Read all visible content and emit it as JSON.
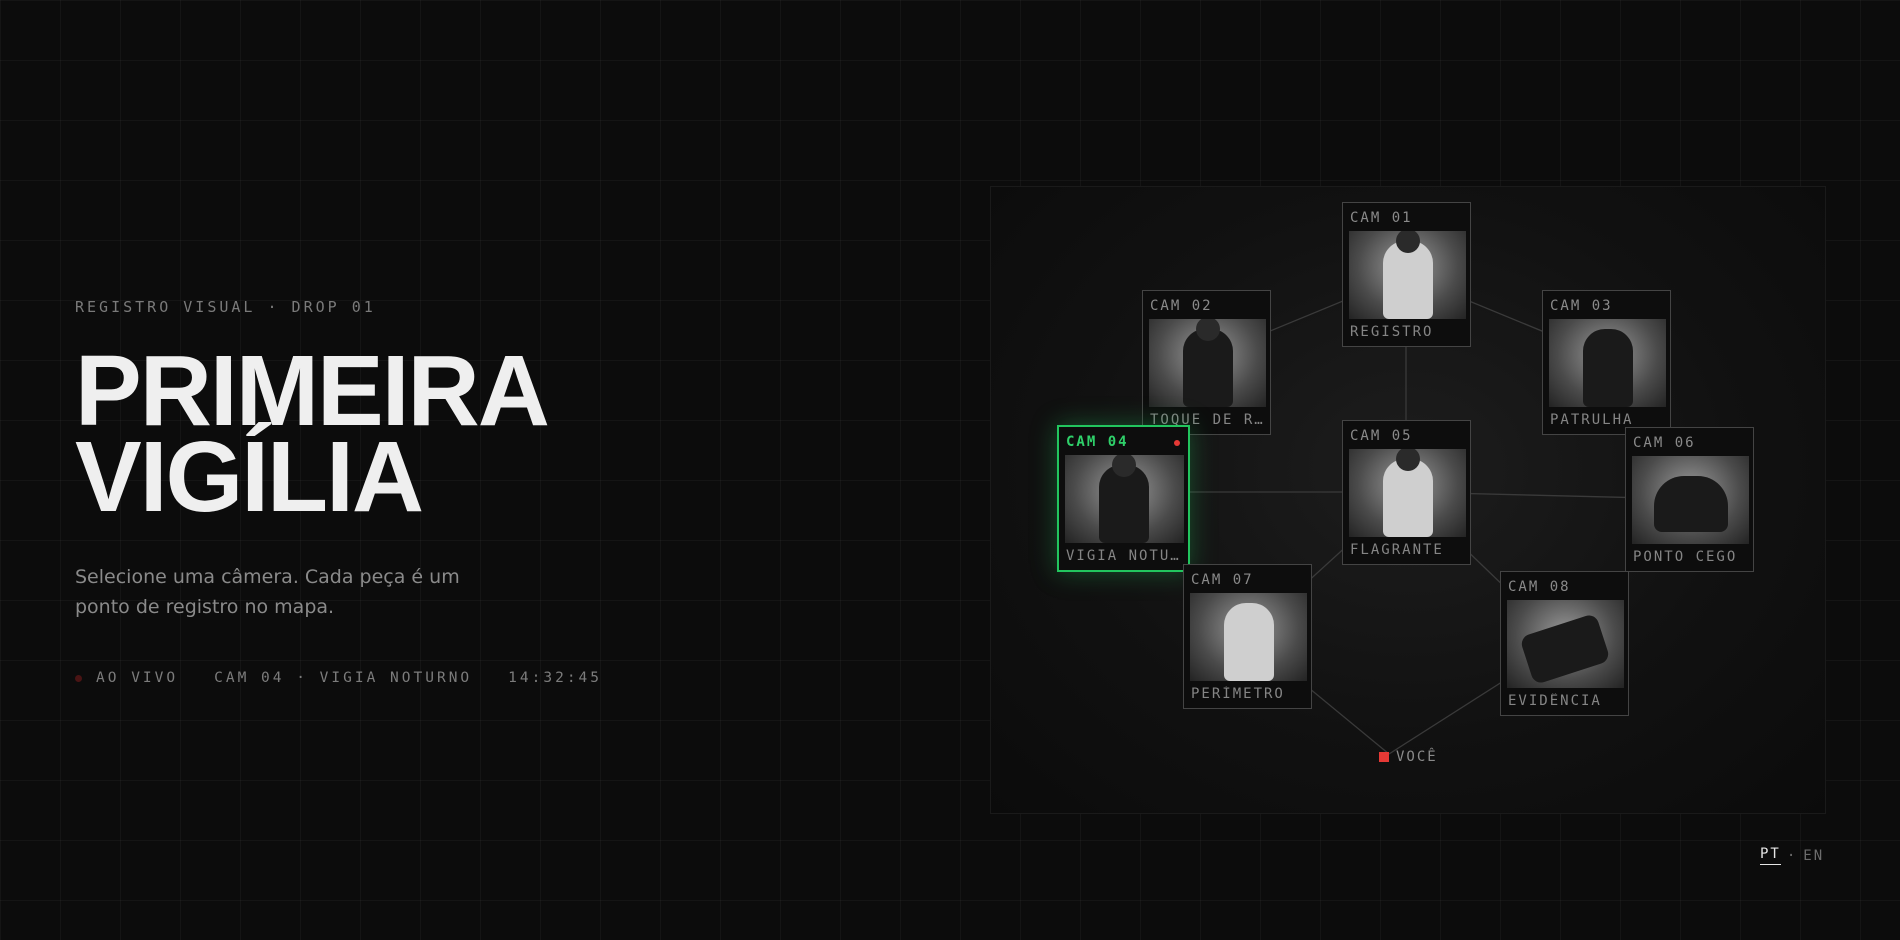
{
  "hero": {
    "eyebrow": "REGISTRO VISUAL · DROP 01",
    "title_line1": "PRIMEIRA",
    "title_line2": "VIGÍLIA",
    "subtitle": "Selecione uma câmera. Cada peça é um ponto de registro no mapa."
  },
  "status": {
    "live": "AO VIVO",
    "camera": "CAM 04 · VIGIA NOTURNO",
    "time": "14:32:45"
  },
  "cameras": [
    {
      "id": "CAM 01",
      "caption": "REGISTRO",
      "active": false
    },
    {
      "id": "CAM 02",
      "caption": "TOQUE DE RECOLHER",
      "active": false
    },
    {
      "id": "CAM 03",
      "caption": "PATRULHA",
      "active": false
    },
    {
      "id": "CAM 04",
      "caption": "VIGIA NOTURNO",
      "active": true
    },
    {
      "id": "CAM 05",
      "caption": "FLAGRANTE",
      "active": false
    },
    {
      "id": "CAM 06",
      "caption": "PONTO CEGO",
      "active": false
    },
    {
      "id": "CAM 07",
      "caption": "PERÍMETRO",
      "active": false
    },
    {
      "id": "CAM 08",
      "caption": "EVIDÊNCIA",
      "active": false
    }
  ],
  "you_marker": "VOCÊ",
  "lang": {
    "pt": "PT",
    "sep": "·",
    "en": "EN"
  },
  "colors": {
    "active": "#22c55e",
    "rec": "#e53935",
    "background": "#0c0c0c"
  }
}
